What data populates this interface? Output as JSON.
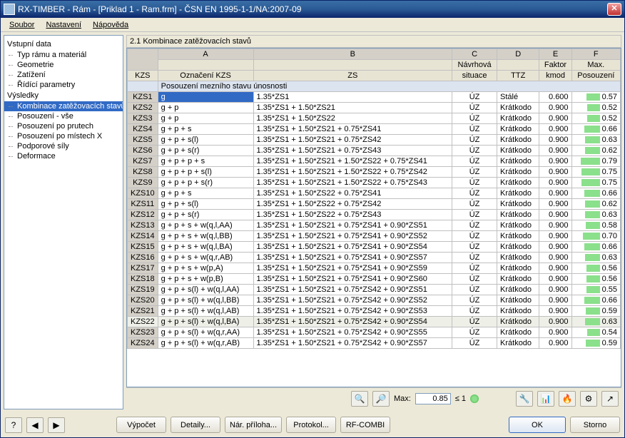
{
  "title": "RX-TIMBER - Rám - [Priklad 1 - Ram.frm] - ČSN EN 1995-1-1/NA:2007-09",
  "menu": [
    "Soubor",
    "Nastavení",
    "Nápověda"
  ],
  "sidebar": {
    "roots": [
      {
        "label": "Vstupní data",
        "children": [
          "Typ rámu a materiál",
          "Geometrie",
          "Zatížení",
          "Řídící parametry"
        ]
      },
      {
        "label": "Výsledky",
        "children": [
          "Kombinace zatěžovacích stavů",
          "Posouzení - vše",
          "Posouzení po prutech",
          "Posouzení po místech X",
          "Podporové síly",
          "Deformace"
        ],
        "selected": 0
      }
    ]
  },
  "panel_title": "2.1 Kombinace zatěžovacích stavů",
  "letters": [
    "A",
    "B",
    "C",
    "D",
    "E",
    "F"
  ],
  "columns_row1": [
    "",
    "",
    "",
    "Návrhová",
    "",
    "Faktor",
    "Max."
  ],
  "columns_row2": [
    "KZS",
    "Označení KZS",
    "ZS",
    "situace",
    "TTZ",
    "kmod",
    "Posouzení"
  ],
  "section_header": "Posouzení mezního stavu únosnosti",
  "rows": [
    {
      "id": "KZS1",
      "oz": "g",
      "zs": "1.35*ZS1",
      "sit": "ÚZ",
      "ttz": "Stálé",
      "kmod": "0.600",
      "pos": 0.57
    },
    {
      "id": "KZS2",
      "oz": "g + p",
      "zs": "1.35*ZS1 + 1.50*ZS21",
      "sit": "ÚZ",
      "ttz": "Krátkodo",
      "kmod": "0.900",
      "pos": 0.52
    },
    {
      "id": "KZS3",
      "oz": "g + p",
      "zs": "1.35*ZS1 + 1.50*ZS22",
      "sit": "ÚZ",
      "ttz": "Krátkodo",
      "kmod": "0.900",
      "pos": 0.52
    },
    {
      "id": "KZS4",
      "oz": "g + p + s",
      "zs": "1.35*ZS1 + 1.50*ZS21 + 0.75*ZS41",
      "sit": "ÚZ",
      "ttz": "Krátkodo",
      "kmod": "0.900",
      "pos": 0.66
    },
    {
      "id": "KZS5",
      "oz": "g + p + s(l)",
      "zs": "1.35*ZS1 + 1.50*ZS21 + 0.75*ZS42",
      "sit": "ÚZ",
      "ttz": "Krátkodo",
      "kmod": "0.900",
      "pos": 0.63
    },
    {
      "id": "KZS6",
      "oz": "g + p + s(r)",
      "zs": "1.35*ZS1 + 1.50*ZS21 + 0.75*ZS43",
      "sit": "ÚZ",
      "ttz": "Krátkodo",
      "kmod": "0.900",
      "pos": 0.62
    },
    {
      "id": "KZS7",
      "oz": "g + p + p + s",
      "zs": "1.35*ZS1 + 1.50*ZS21 + 1.50*ZS22 + 0.75*ZS41",
      "sit": "ÚZ",
      "ttz": "Krátkodo",
      "kmod": "0.900",
      "pos": 0.79
    },
    {
      "id": "KZS8",
      "oz": "g + p + p + s(l)",
      "zs": "1.35*ZS1 + 1.50*ZS21 + 1.50*ZS22 + 0.75*ZS42",
      "sit": "ÚZ",
      "ttz": "Krátkodo",
      "kmod": "0.900",
      "pos": 0.75
    },
    {
      "id": "KZS9",
      "oz": "g + p + p + s(r)",
      "zs": "1.35*ZS1 + 1.50*ZS21 + 1.50*ZS22 + 0.75*ZS43",
      "sit": "ÚZ",
      "ttz": "Krátkodo",
      "kmod": "0.900",
      "pos": 0.75
    },
    {
      "id": "KZS10",
      "oz": "g + p + s",
      "zs": "1.35*ZS1 + 1.50*ZS22 + 0.75*ZS41",
      "sit": "ÚZ",
      "ttz": "Krátkodo",
      "kmod": "0.900",
      "pos": 0.66
    },
    {
      "id": "KZS11",
      "oz": "g + p + s(l)",
      "zs": "1.35*ZS1 + 1.50*ZS22 + 0.75*ZS42",
      "sit": "ÚZ",
      "ttz": "Krátkodo",
      "kmod": "0.900",
      "pos": 0.62
    },
    {
      "id": "KZS12",
      "oz": "g + p + s(r)",
      "zs": "1.35*ZS1 + 1.50*ZS22 + 0.75*ZS43",
      "sit": "ÚZ",
      "ttz": "Krátkodo",
      "kmod": "0.900",
      "pos": 0.63
    },
    {
      "id": "KZS13",
      "oz": "g + p + s + w(q,l,AA)",
      "zs": "1.35*ZS1 + 1.50*ZS21 + 0.75*ZS41 + 0.90*ZS51",
      "sit": "ÚZ",
      "ttz": "Krátkodo",
      "kmod": "0.900",
      "pos": 0.58
    },
    {
      "id": "KZS14",
      "oz": "g + p + s + w(q,l,BB)",
      "zs": "1.35*ZS1 + 1.50*ZS21 + 0.75*ZS41 + 0.90*ZS52",
      "sit": "ÚZ",
      "ttz": "Krátkodo",
      "kmod": "0.900",
      "pos": 0.7
    },
    {
      "id": "KZS15",
      "oz": "g + p + s + w(q,l,BA)",
      "zs": "1.35*ZS1 + 1.50*ZS21 + 0.75*ZS41 + 0.90*ZS54",
      "sit": "ÚZ",
      "ttz": "Krátkodo",
      "kmod": "0.900",
      "pos": 0.66
    },
    {
      "id": "KZS16",
      "oz": "g + p + s + w(q,r,AB)",
      "zs": "1.35*ZS1 + 1.50*ZS21 + 0.75*ZS41 + 0.90*ZS57",
      "sit": "ÚZ",
      "ttz": "Krátkodo",
      "kmod": "0.900",
      "pos": 0.63
    },
    {
      "id": "KZS17",
      "oz": "g + p + s + w(p,A)",
      "zs": "1.35*ZS1 + 1.50*ZS21 + 0.75*ZS41 + 0.90*ZS59",
      "sit": "ÚZ",
      "ttz": "Krátkodo",
      "kmod": "0.900",
      "pos": 0.56
    },
    {
      "id": "KZS18",
      "oz": "g + p + s + w(p,B)",
      "zs": "1.35*ZS1 + 1.50*ZS21 + 0.75*ZS41 + 0.90*ZS60",
      "sit": "ÚZ",
      "ttz": "Krátkodo",
      "kmod": "0.900",
      "pos": 0.56
    },
    {
      "id": "KZS19",
      "oz": "g + p + s(l) + w(q,l,AA)",
      "zs": "1.35*ZS1 + 1.50*ZS21 + 0.75*ZS42 + 0.90*ZS51",
      "sit": "ÚZ",
      "ttz": "Krátkodo",
      "kmod": "0.900",
      "pos": 0.55
    },
    {
      "id": "KZS20",
      "oz": "g + p + s(l) + w(q,l,BB)",
      "zs": "1.35*ZS1 + 1.50*ZS21 + 0.75*ZS42 + 0.90*ZS52",
      "sit": "ÚZ",
      "ttz": "Krátkodo",
      "kmod": "0.900",
      "pos": 0.66
    },
    {
      "id": "KZS21",
      "oz": "g + p + s(l) + w(q,l,AB)",
      "zs": "1.35*ZS1 + 1.50*ZS21 + 0.75*ZS42 + 0.90*ZS53",
      "sit": "ÚZ",
      "ttz": "Krátkodo",
      "kmod": "0.900",
      "pos": 0.59
    },
    {
      "id": "KZS22",
      "oz": "g + p + s(l) + w(q,l,BA)",
      "zs": "1.35*ZS1 + 1.50*ZS21 + 0.75*ZS42 + 0.90*ZS54",
      "sit": "ÚZ",
      "ttz": "Krátkodo",
      "kmod": "0.900",
      "pos": 0.63,
      "hl": true
    },
    {
      "id": "KZS23",
      "oz": "g + p + s(l) + w(q,r,AA)",
      "zs": "1.35*ZS1 + 1.50*ZS21 + 0.75*ZS42 + 0.90*ZS55",
      "sit": "ÚZ",
      "ttz": "Krátkodo",
      "kmod": "0.900",
      "pos": 0.54
    },
    {
      "id": "KZS24",
      "oz": "g + p + s(l) + w(q,r,AB)",
      "zs": "1.35*ZS1 + 1.50*ZS21 + 0.75*ZS42 + 0.90*ZS57",
      "sit": "ÚZ",
      "ttz": "Krátkodo",
      "kmod": "0.900",
      "pos": 0.59
    }
  ],
  "max_label": "Max:",
  "max_value": "0.85",
  "max_limit": "≤ 1",
  "buttons": {
    "calc": "Výpočet",
    "details": "Detaily...",
    "nar": "Nár. příloha...",
    "protokol": "Protokol...",
    "rfcombi": "RF-COMBI",
    "ok": "OK",
    "storno": "Storno"
  }
}
